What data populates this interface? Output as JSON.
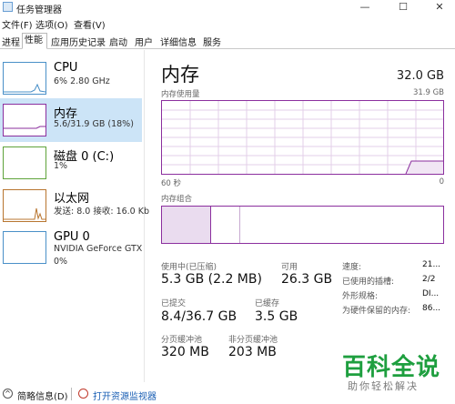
{
  "window": {
    "title": "任务管理器",
    "min": "—",
    "max": "☐",
    "close": "✕"
  },
  "menu": [
    "文件(F)",
    "选项(O)",
    "查看(V)"
  ],
  "tabs": [
    "进程",
    "性能",
    "应用历史记录",
    "启动",
    "用户",
    "详细信息",
    "服务"
  ],
  "active_tab": "性能",
  "resources": [
    {
      "name": "CPU",
      "sub": "6% 2.80 GHz"
    },
    {
      "name": "内存",
      "sub": "5.6/31.9 GB (18%)"
    },
    {
      "name": "磁盘 0 (C:)",
      "sub": "1%"
    },
    {
      "name": "以太网",
      "sub": "发送: 8.0 接收: 16.0 Kb"
    },
    {
      "name": "GPU 0",
      "sub": "NVIDIA GeForce GTX",
      "sub2": "0%"
    }
  ],
  "panel": {
    "title": "内存",
    "total": "32.0 GB",
    "usage_caption": "内存使用量",
    "usage_max": "31.9 GB",
    "time_left": "60 秒",
    "time_right": "0",
    "composition_caption": "内存组合",
    "stats": {
      "in_use_label": "使用中(已压缩)",
      "in_use_value": "5.3 GB (2.2 MB)",
      "available_label": "可用",
      "available_value": "26.3 GB",
      "committed_label": "已提交",
      "committed_value": "8.4/36.7 GB",
      "cached_label": "已缓存",
      "cached_value": "3.5 GB",
      "paged_label": "分页缓冲池",
      "paged_value": "320 MB",
      "nonpaged_label": "非分页缓冲池",
      "nonpaged_value": "203 MB"
    },
    "details": [
      {
        "label": "速度:",
        "value": "21..."
      },
      {
        "label": "已使用的插槽:",
        "value": "2/2"
      },
      {
        "label": "外形规格:",
        "value": "DI..."
      },
      {
        "label": "为硬件保留的内存:",
        "value": "86..."
      }
    ]
  },
  "footer": {
    "fewer_details": "简略信息(D)",
    "open_monitor": "打开资源监视器"
  },
  "watermark": {
    "big": "百科全说",
    "small": "助你轻松解决"
  },
  "colors": {
    "memory": "#8b2f9e",
    "cpu": "#4a90c8",
    "disk": "#5ea33a",
    "ethernet": "#b8752f",
    "gpu": "#4a90c8",
    "selected": "#cce4f7"
  }
}
